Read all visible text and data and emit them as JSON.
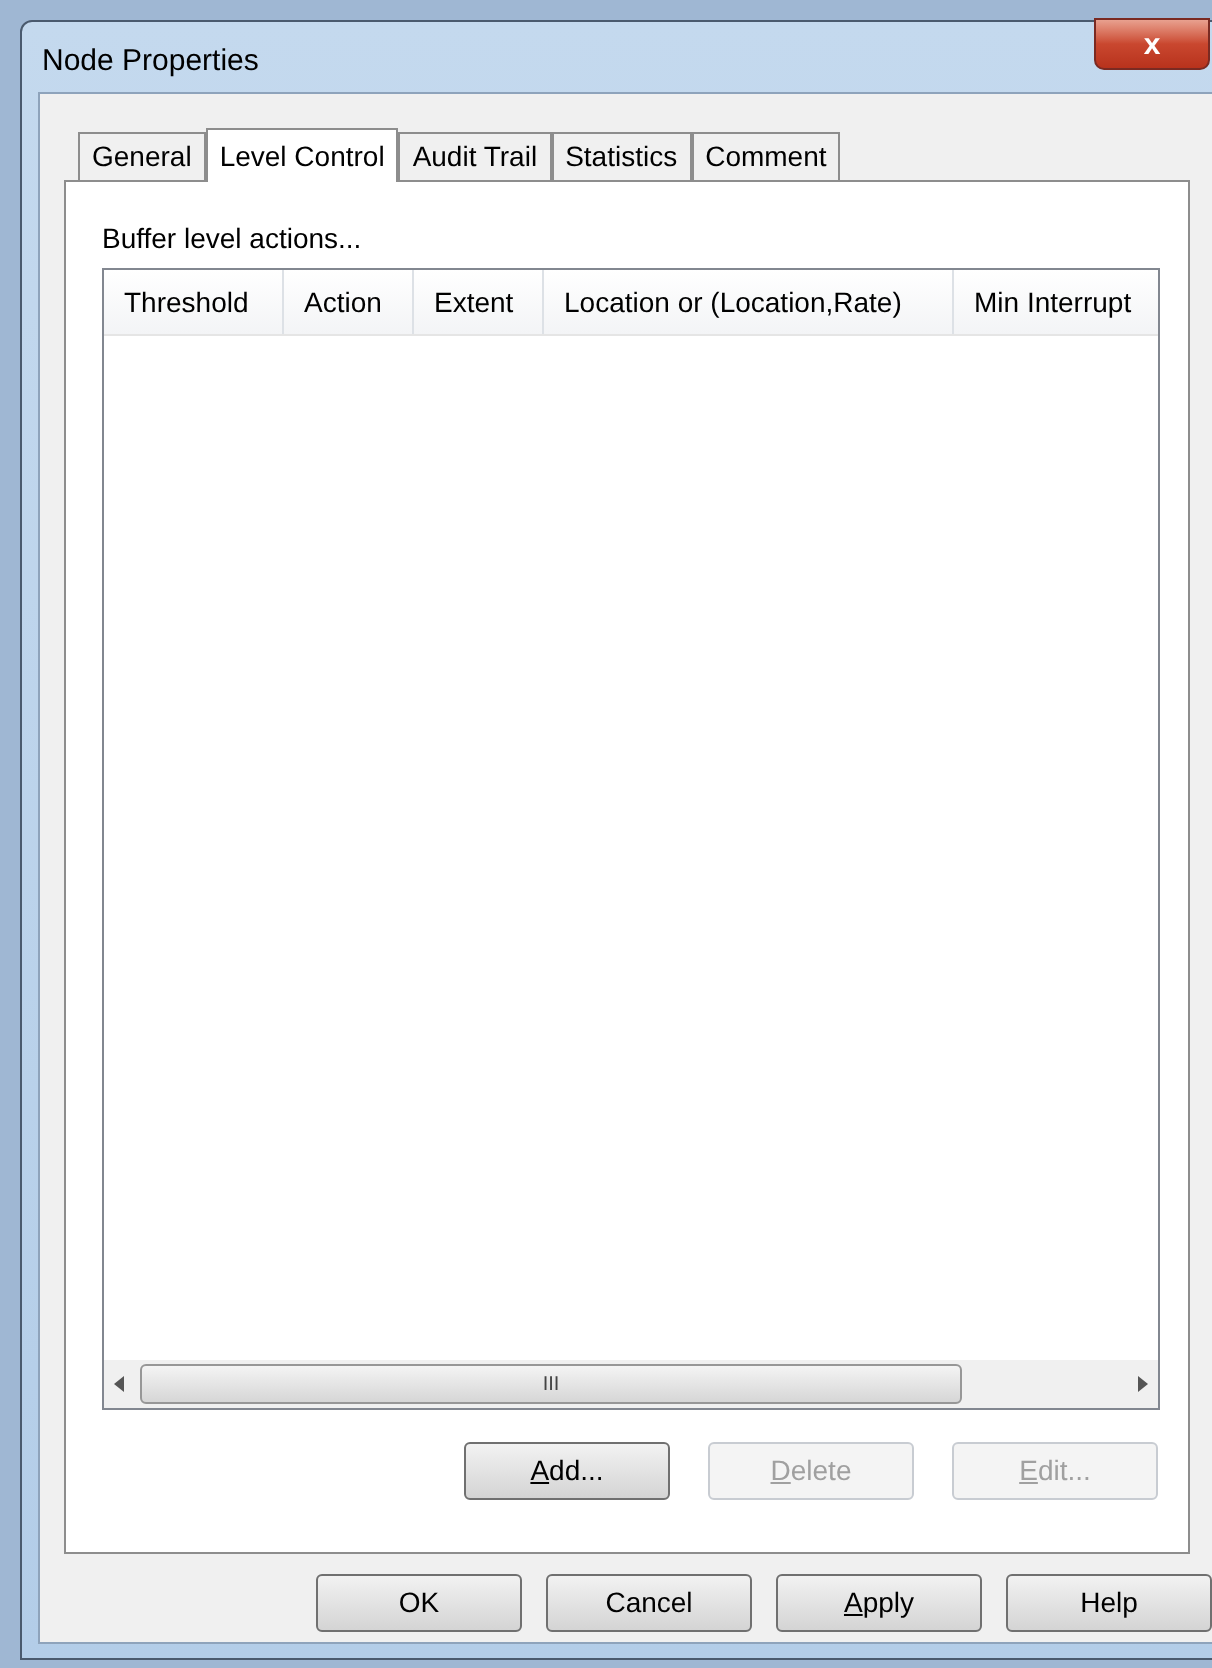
{
  "window": {
    "title": "Node Properties",
    "close": "x"
  },
  "tabs": [
    {
      "label": "General",
      "selected": false
    },
    {
      "label": "Level Control",
      "selected": true
    },
    {
      "label": "Audit Trail",
      "selected": false
    },
    {
      "label": "Statistics",
      "selected": false
    },
    {
      "label": "Comment",
      "selected": false
    }
  ],
  "section_label": "Buffer level actions...",
  "table": {
    "columns": [
      "Threshold",
      "Action",
      "Extent",
      "Location or (Location,Rate)",
      "Min Interrupt"
    ],
    "scroll_grip": "III"
  },
  "list_buttons": [
    {
      "mnemonic": "A",
      "rest": "dd...",
      "disabled": false
    },
    {
      "mnemonic": "D",
      "rest": "elete",
      "disabled": true
    },
    {
      "mnemonic": "E",
      "rest": "dit...",
      "disabled": true
    }
  ],
  "dialog_buttons": [
    {
      "rest": "OK"
    },
    {
      "rest": "Cancel"
    },
    {
      "mnemonic": "A",
      "rest": "pply"
    },
    {
      "rest": "Help"
    }
  ]
}
